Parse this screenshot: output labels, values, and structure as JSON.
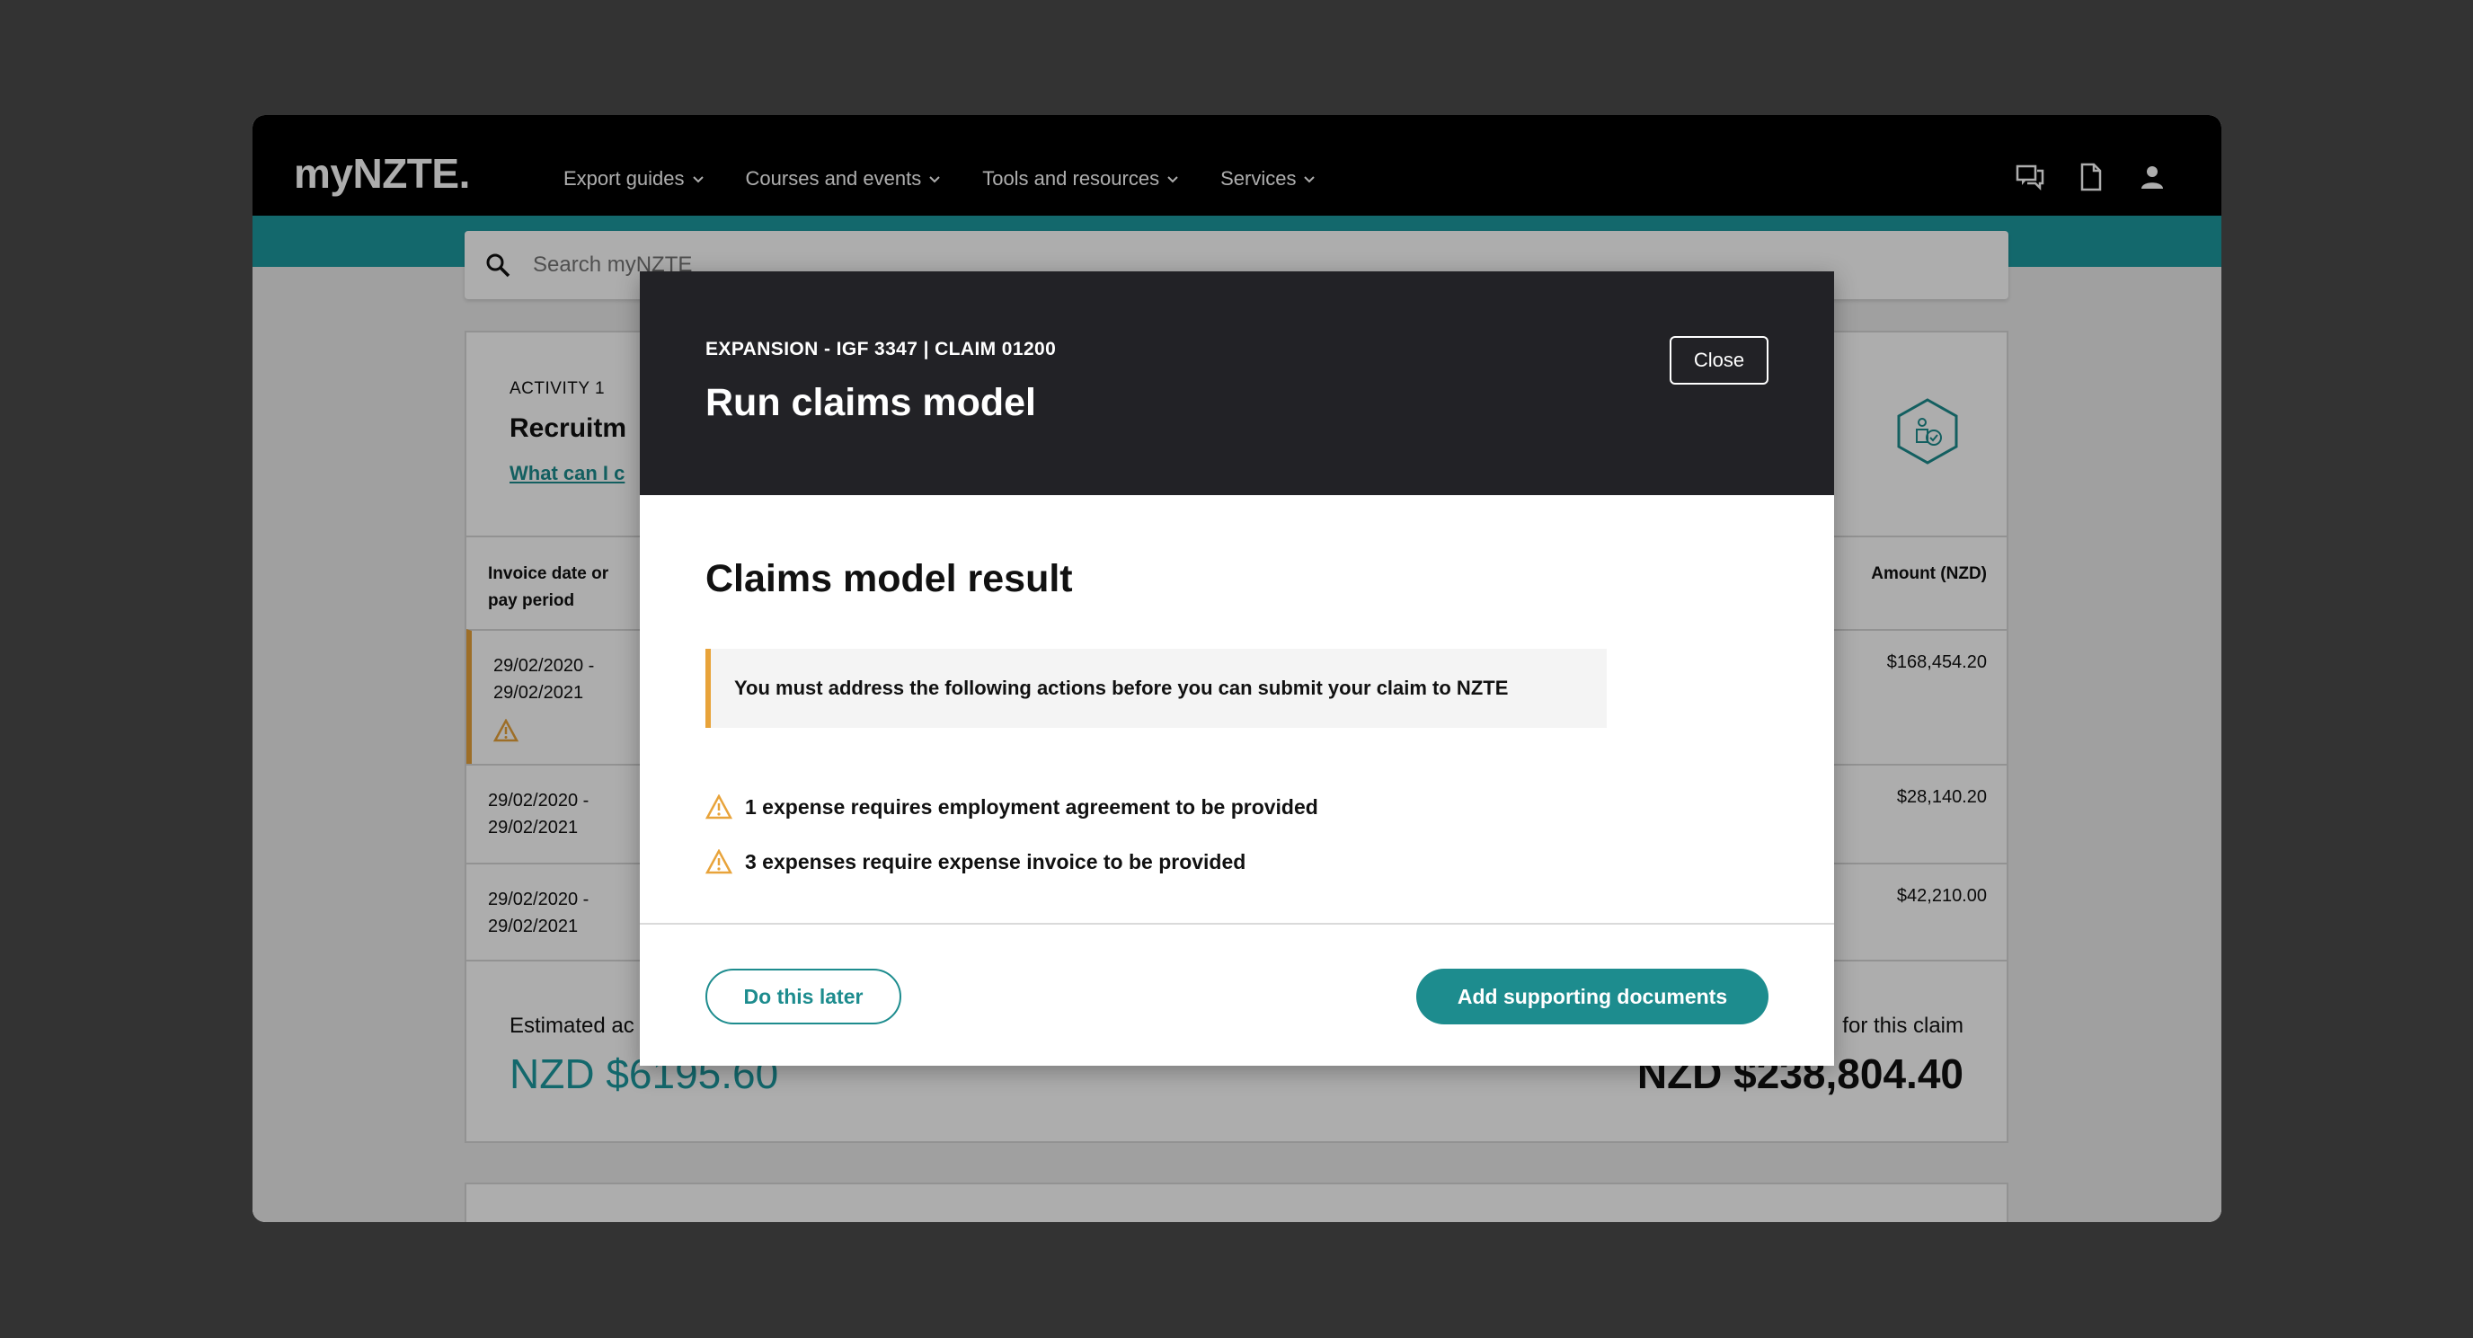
{
  "header": {
    "logo": "myNZTE.",
    "nav": [
      {
        "label": "Export guides"
      },
      {
        "label": "Courses and events"
      },
      {
        "label": "Tools and resources"
      },
      {
        "label": "Services"
      }
    ],
    "icons": [
      "chat-icon",
      "document-icon",
      "user-icon"
    ]
  },
  "search": {
    "placeholder": "Search myNZTE"
  },
  "activity": {
    "label": "ACTIVITY 1",
    "title": "Recruitm",
    "link": "What can I c",
    "icon": "hexagon-person-check-icon"
  },
  "table": {
    "header_date": "Invoice date or pay period",
    "header_amount": "Amount (NZD)",
    "rows": [
      {
        "date": "29/02/2020  -\n29/02/2021",
        "amount": "$168,454.20",
        "warning": true
      },
      {
        "date": "29/02/2020  -\n29/02/2021",
        "amount": "$28,140.20",
        "warning": false
      },
      {
        "date": "29/02/2020  -\n29/02/2021",
        "amount": "$42,210.00",
        "warning": false
      }
    ]
  },
  "summary": {
    "estimated_label": "Estimated ac",
    "estimated_value": "NZD $6195.60",
    "claim_label": "for this claim",
    "claim_value": "NZD $238,804.40"
  },
  "modal": {
    "eyebrow": "EXPANSION - IGF 3347 | CLAIM 01200",
    "title": "Run claims model",
    "close_label": "Close",
    "result_title": "Claims model result",
    "alert": "You must address the following actions before you can submit your claim to NZTE",
    "issues": [
      "1 expense requires employment agreement to be provided",
      "3 expenses require expense invoice to be provided"
    ],
    "later_label": "Do this later",
    "add_label": "Add supporting documents"
  },
  "colors": {
    "teal": "#1d9aa0",
    "button_teal": "#1d8c8e",
    "warning": "#e8a33a",
    "modal_header": "#222226"
  }
}
